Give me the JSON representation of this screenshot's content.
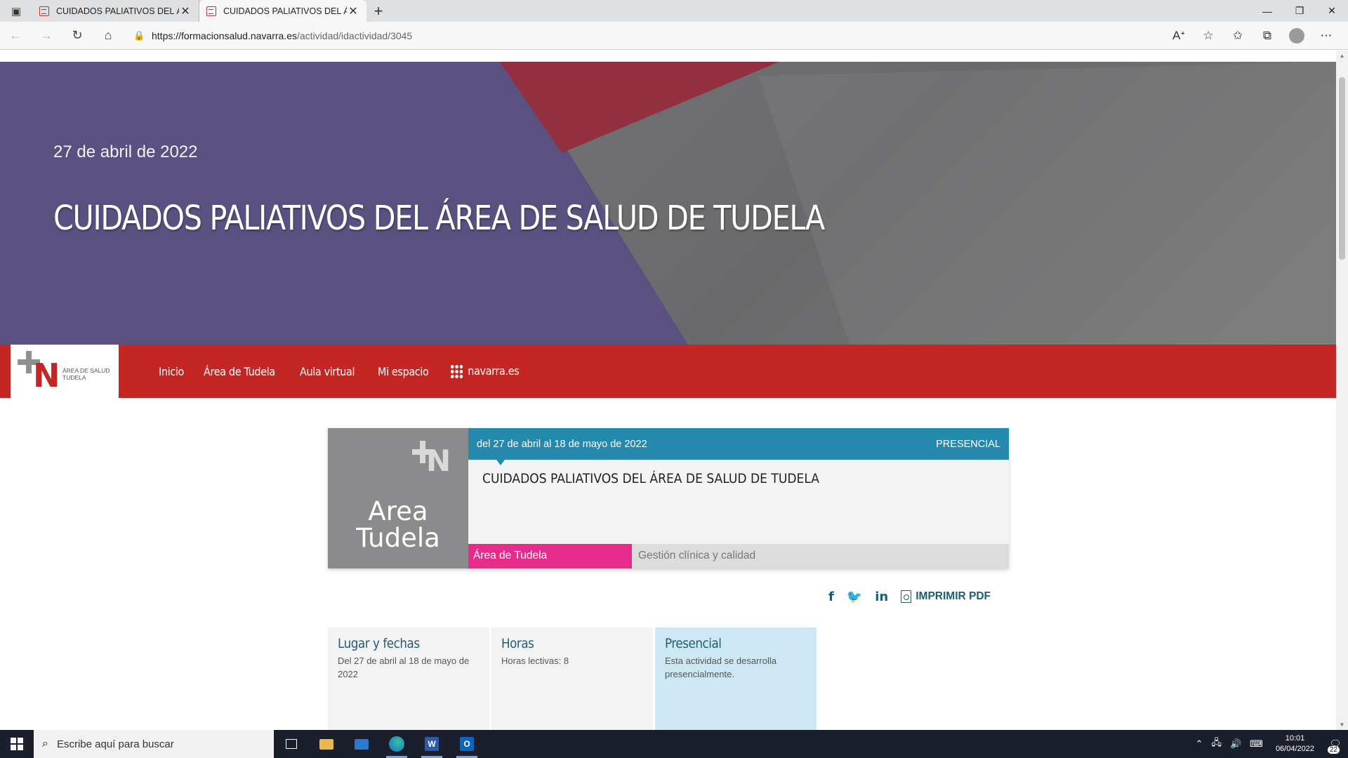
{
  "browser": {
    "tabs": [
      {
        "title": "CUIDADOS PALIATIVOS DEL ÁRE",
        "active": false
      },
      {
        "title": "CUIDADOS PALIATIVOS DEL ÁRE",
        "active": true
      }
    ],
    "new_tab_symbol": "+",
    "url_host": "https://formacionsalud.navarra.es",
    "url_path": "/actividad/idactividad/3045",
    "icons": [
      "back-icon",
      "forward-icon",
      "refresh-icon",
      "home-icon",
      "lock-icon",
      "read-aloud-icon",
      "favorite-add-icon",
      "favorites-icon",
      "collections-icon",
      "profile-icon",
      "more-icon"
    ]
  },
  "hero": {
    "date": "27 de abril de 2022",
    "title": "CUIDADOS PALIATIVOS DEL ÁREA DE SALUD DE TUDELA",
    "colors": {
      "purple": "#5a5181",
      "red": "#93303f",
      "gray": "#6f6f71"
    }
  },
  "navbar": {
    "logo_text": "ÁREA DE SALUD TUDELA",
    "items": [
      "Inicio",
      "Área de Tudela",
      "Aula virtual",
      "Mi espacio",
      "navarra.es"
    ],
    "color": "#c42623"
  },
  "card": {
    "thumb_text": "Area Tudela",
    "dates": "del 27 de abril al 18 de mayo de 2022",
    "modality": "PRESENCIAL",
    "title": "CUIDADOS PALIATIVOS DEL ÁREA DE SALUD DE TUDELA",
    "area_tag": "Área de Tudela",
    "topic_tag": "Gestión clínica y calidad",
    "colors": {
      "header": "#2589ad",
      "area_tag": "#e62b8a",
      "topic_tag": "#dcdcdc"
    }
  },
  "share": {
    "icons": [
      "facebook-icon",
      "twitter-icon",
      "linkedin-icon",
      "pdf-icon"
    ],
    "pdf_label": "IMPRIMIR PDF"
  },
  "info": [
    {
      "title": "Lugar y fechas",
      "text": "Del 27 de abril al 18 de mayo de 2022"
    },
    {
      "title": "Horas",
      "text": "Horas lectivas: 8"
    },
    {
      "title": "Presencial",
      "text": "Esta actividad se desarrolla presencialmente."
    }
  ],
  "taskbar": {
    "search_placeholder": "Escribe aquí para buscar",
    "time": "10:01",
    "date": "06/04/2022",
    "notifications": "22"
  }
}
